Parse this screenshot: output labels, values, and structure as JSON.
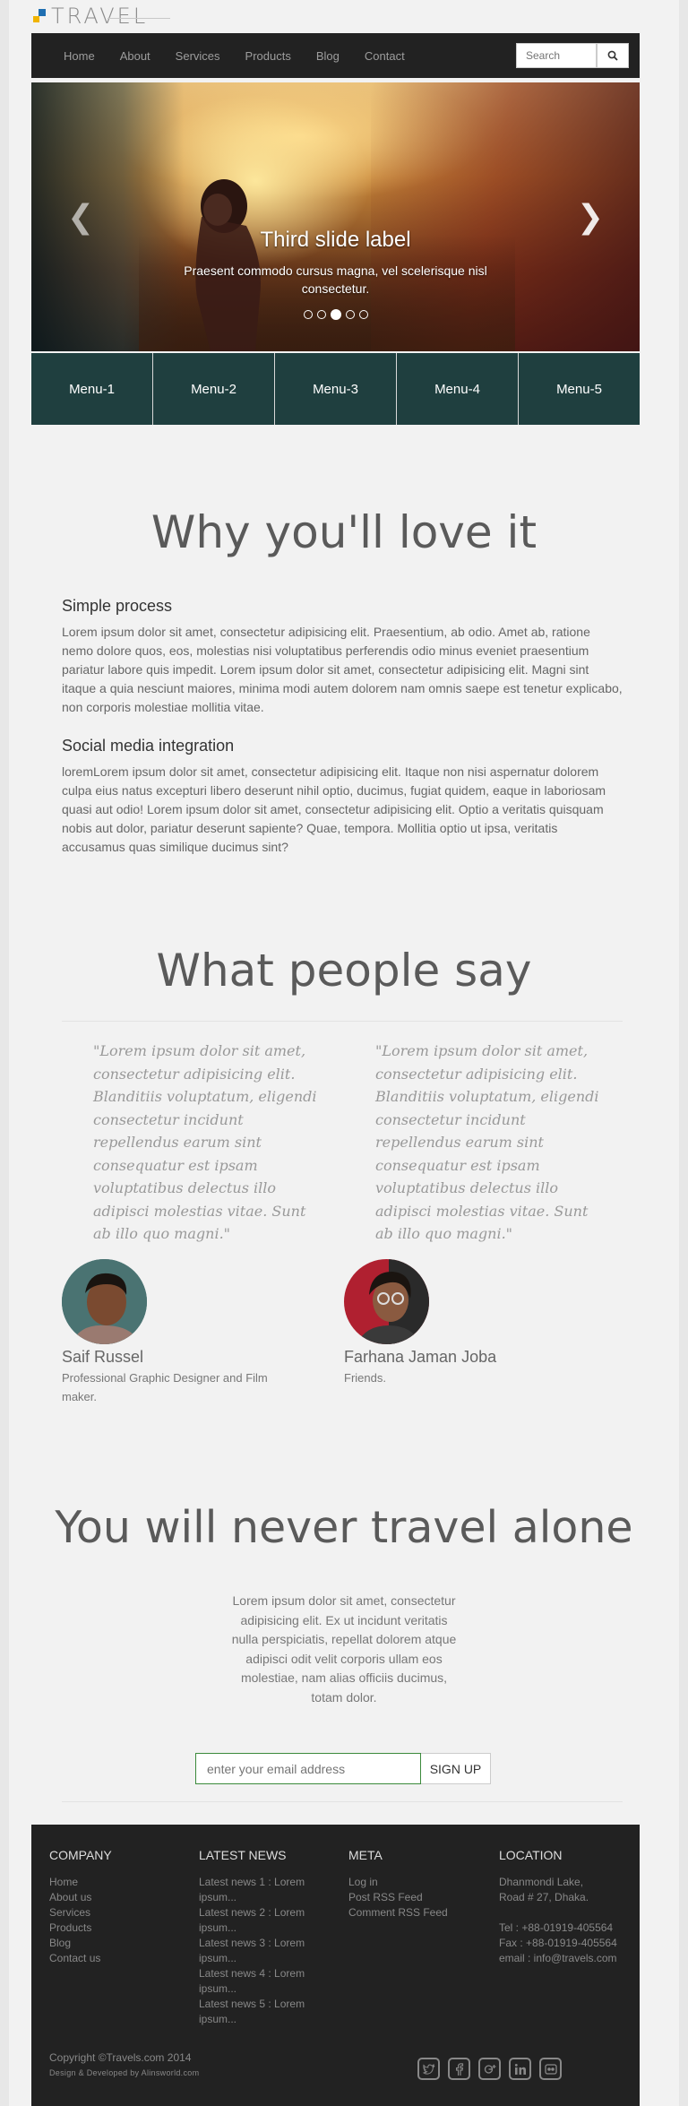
{
  "brand": {
    "logo_text": "TRAVEL",
    "colors": {
      "mark_blue": "#1f6fb2",
      "mark_yellow": "#f0b400"
    }
  },
  "nav": {
    "items": [
      "Home",
      "About",
      "Services",
      "Products",
      "Blog",
      "Contact"
    ],
    "search_placeholder": "Search",
    "search_icon": "search-icon"
  },
  "carousel": {
    "title": "Third slide label",
    "text": "Praesent commodo cursus magna, vel scelerisque nisl consectetur.",
    "slides_count": 5,
    "active_slide": 3,
    "prev_icon": "chevron-left-icon",
    "next_icon": "chevron-right-icon"
  },
  "menu_tiles": [
    "Menu-1",
    "Menu-2",
    "Menu-3",
    "Menu-4",
    "Menu-5"
  ],
  "why": {
    "title": "Why you'll love it",
    "features": [
      {
        "heading": "Simple process",
        "text": "Lorem ipsum dolor sit amet, consectetur adipisicing elit. Praesentium, ab odio. Amet ab, ratione nemo dolore quos, eos, molestias nisi voluptatibus perferendis odio minus eveniet praesentium pariatur labore quis impedit. Lorem ipsum dolor sit amet, consectetur adipisicing elit. Magni sint itaque a quia nesciunt maiores, minima modi autem dolorem nam omnis saepe est tenetur explicabo, non corporis molestiae mollitia vitae."
      },
      {
        "heading": "Social media integration",
        "text": "loremLorem ipsum dolor sit amet, consectetur adipisicing elit. Itaque non nisi aspernatur dolorem culpa eius natus excepturi libero deserunt nihil optio, ducimus, fugiat quidem, eaque in laboriosam quasi aut odio! Lorem ipsum dolor sit amet, consectetur adipisicing elit. Optio a veritatis quisquam nobis aut dolor, pariatur deserunt sapiente? Quae, tempora. Mollitia optio ut ipsa, veritatis accusamus quas similique ducimus sint?"
      }
    ]
  },
  "testimonials": {
    "title": "What people say",
    "items": [
      {
        "quote": "\"Lorem ipsum dolor sit amet, consectetur adipisicing elit. Blanditiis voluptatum, eligendi consectetur incidunt repellendus earum sint consequatur est ipsam voluptatibus delectus illo adipisci molestias vitae. Sunt ab illo quo magni.\"",
        "name": "Saif Russel",
        "role": "Professional Graphic Designer and Film maker."
      },
      {
        "quote": "\"Lorem ipsum dolor sit amet, consectetur adipisicing elit. Blanditiis voluptatum, eligendi consectetur incidunt repellendus earum sint consequatur est ipsam voluptatibus delectus illo adipisci molestias vitae. Sunt ab illo quo magni.\"",
        "name": "Farhana Jaman Joba",
        "role": "Friends."
      }
    ]
  },
  "travel_alone": {
    "title": "You will never travel alone",
    "text": "Lorem ipsum dolor sit amet, consectetur adipisicing elit. Ex ut incidunt veritatis nulla perspiciatis, repellat dolorem atque adipisci odit velit corporis ullam eos molestiae, nam alias officiis ducimus, totam dolor.",
    "email_placeholder": "enter your email address",
    "signup_label": "SIGN UP"
  },
  "footer": {
    "company": {
      "heading": "COMPANY",
      "links": [
        "Home",
        "About us",
        "Services",
        "Products",
        "Blog",
        "Contact us"
      ]
    },
    "news": {
      "heading": "LATEST NEWS",
      "items": [
        "Latest news 1 : Lorem ipsum...",
        "Latest news 2 : Lorem ipsum...",
        "Latest news 3 : Lorem ipsum...",
        "Latest news 4 : Lorem ipsum...",
        "Latest news 5 : Lorem ipsum..."
      ]
    },
    "meta": {
      "heading": "META",
      "links": [
        "Log in",
        "Post RSS Feed",
        "Comment RSS Feed"
      ]
    },
    "location": {
      "heading": "LOCATION",
      "address_line1": "Dhanmondi Lake,",
      "address_line2": "Road # 27, Dhaka.",
      "tel": "Tel : +88-01919-405564",
      "fax": "Fax : +88-01919-405564",
      "email": "email : info@travels.com"
    },
    "copyright": "Copyright ©Travels.com 2014",
    "credits": "Design & Developed by Alinsworld.com",
    "social_icons": [
      "twitter-icon",
      "facebook-icon",
      "google-plus-icon",
      "linkedin-icon",
      "flickr-icon"
    ]
  }
}
